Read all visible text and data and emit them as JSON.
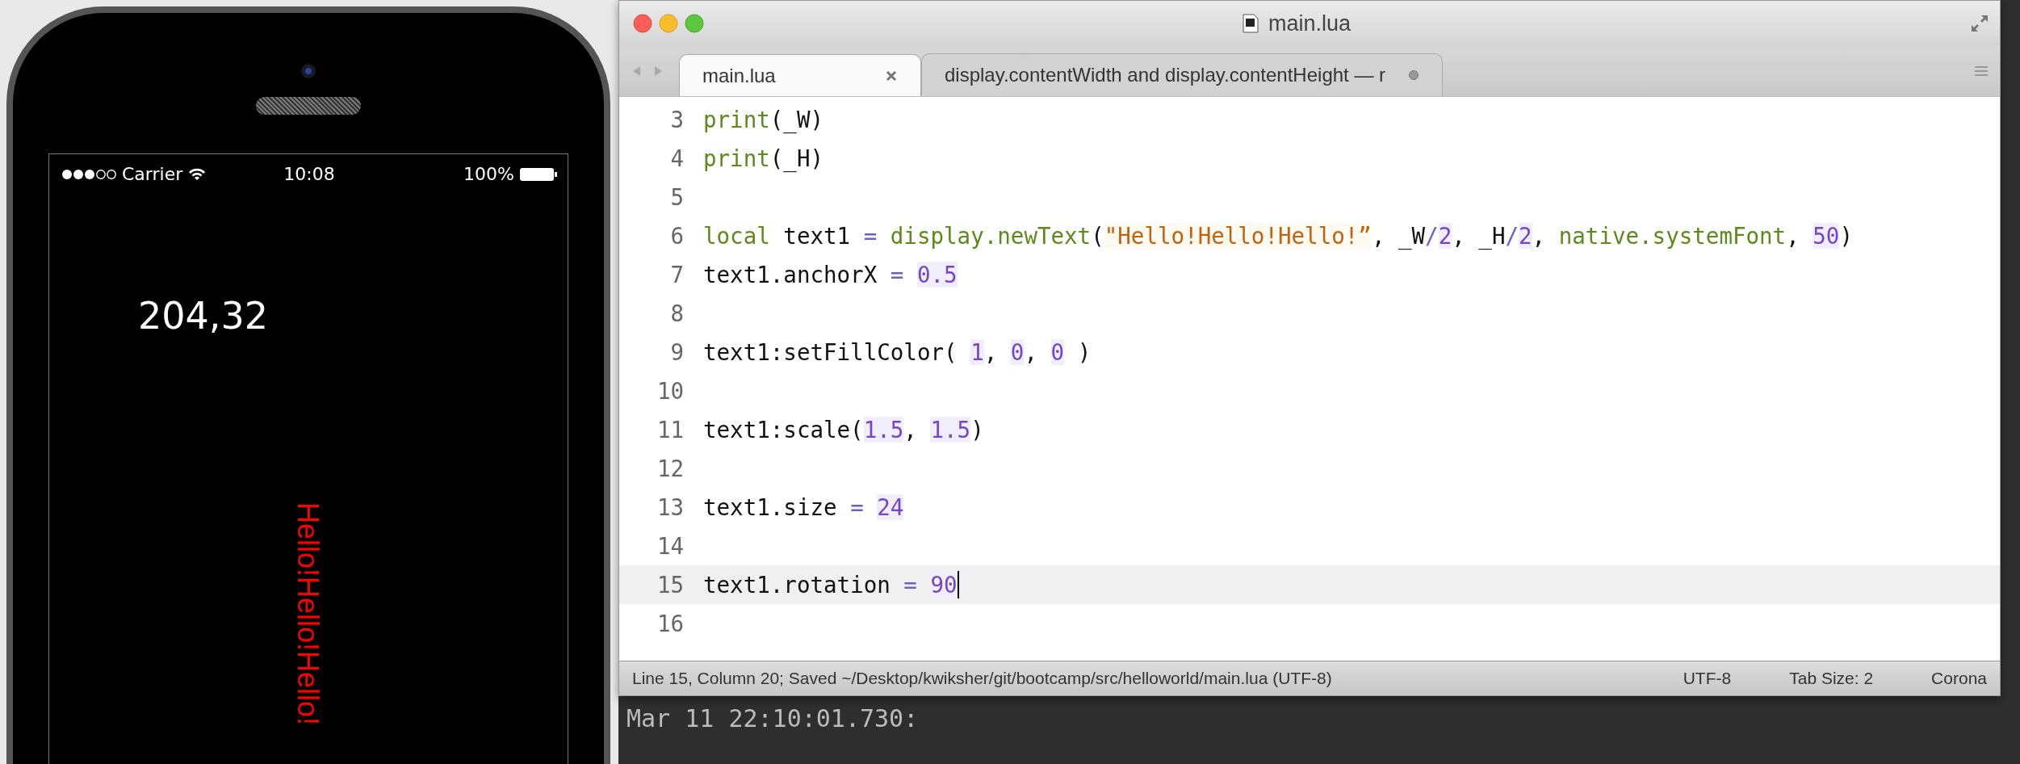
{
  "simulator": {
    "status_bar": {
      "carrier": "Carrier",
      "time": "10:08",
      "battery": "100%"
    },
    "labels": [
      {
        "kind": "plain",
        "text": "204,32"
      },
      {
        "kind": "vertical",
        "text": "Hello!Hello!Hello!"
      }
    ]
  },
  "editor": {
    "window": {
      "title": "main.lua"
    },
    "tabs": [
      {
        "label": "main.lua",
        "selected": true,
        "modified": false
      },
      {
        "label": "display.contentWidth and display.contentHeight — r",
        "selected": false,
        "modified": true
      }
    ],
    "lines": [
      {
        "number": "3",
        "current": false,
        "tokens": [
          {
            "kind": "fn",
            "t": "print"
          },
          {
            "kind": "plain",
            "t": "(_W)"
          }
        ]
      },
      {
        "number": "4",
        "current": false,
        "tokens": [
          {
            "kind": "fn",
            "t": "print"
          },
          {
            "kind": "plain",
            "t": "(_H)"
          }
        ]
      },
      {
        "number": "5",
        "current": false
      },
      {
        "number": "6",
        "current": false,
        "tokens": [
          {
            "kind": "fn",
            "t": "local"
          },
          {
            "kind": "plain",
            "t": " text1"
          },
          {
            "kind": "op",
            "t": " = "
          },
          {
            "kind": "fn",
            "t": "display.newText"
          },
          {
            "kind": "plain",
            "t": "("
          },
          {
            "kind": "str",
            "t": "\"Hello!Hello!Hello!”"
          },
          {
            "kind": "plain",
            "t": ", _W"
          },
          {
            "kind": "op",
            "t": "/"
          },
          {
            "kind": "num",
            "t": "2"
          },
          {
            "kind": "plain",
            "t": ", _H"
          },
          {
            "kind": "op",
            "t": "/"
          },
          {
            "kind": "num",
            "t": "2"
          },
          {
            "kind": "plain",
            "t": ", "
          },
          {
            "kind": "fn",
            "t": "native.systemFont"
          },
          {
            "kind": "plain",
            "t": ", "
          },
          {
            "kind": "num",
            "t": "50"
          },
          {
            "kind": "plain",
            "t": ")"
          }
        ]
      },
      {
        "number": "7",
        "current": false,
        "tokens": [
          {
            "kind": "plain",
            "t": "text1.anchorX"
          },
          {
            "kind": "op",
            "t": " = "
          },
          {
            "kind": "num",
            "t": "0.5"
          }
        ]
      },
      {
        "number": "8",
        "current": false
      },
      {
        "number": "9",
        "current": false,
        "tokens": [
          {
            "kind": "plain",
            "t": "text1:setFillColor( "
          },
          {
            "kind": "num",
            "t": "1"
          },
          {
            "kind": "plain",
            "t": ", "
          },
          {
            "kind": "num",
            "t": "0"
          },
          {
            "kind": "plain",
            "t": ", "
          },
          {
            "kind": "num",
            "t": "0"
          },
          {
            "kind": "plain",
            "t": " )"
          }
        ]
      },
      {
        "number": "10",
        "current": false
      },
      {
        "number": "11",
        "current": false,
        "tokens": [
          {
            "kind": "plain",
            "t": "text1:scale("
          },
          {
            "kind": "num",
            "t": "1.5"
          },
          {
            "kind": "plain",
            "t": ", "
          },
          {
            "kind": "num",
            "t": "1.5"
          },
          {
            "kind": "plain",
            "t": ")"
          }
        ]
      },
      {
        "number": "12",
        "current": false
      },
      {
        "number": "13",
        "current": false,
        "tokens": [
          {
            "kind": "plain",
            "t": "text1.size"
          },
          {
            "kind": "op",
            "t": " = "
          },
          {
            "kind": "num",
            "t": "24"
          }
        ]
      },
      {
        "number": "14",
        "current": false
      },
      {
        "number": "15",
        "current": true,
        "tokens": [
          {
            "kind": "plain",
            "t": "text1.rotation"
          },
          {
            "kind": "op",
            "t": " = "
          },
          {
            "kind": "num",
            "t": "90"
          }
        ]
      },
      {
        "number": "16",
        "current": false
      }
    ],
    "status_bar": {
      "message": "Line 15, Column 20; Saved ~/Desktop/kwiksher/git/bootcamp/src/helloworld/main.lua (UTF-8)",
      "encoding": "UTF-8",
      "tab_size": "Tab Size: 2",
      "syntax": "Corona"
    }
  },
  "console": {
    "lines": [
      "Mar 11 22:10:01.730:"
    ]
  }
}
